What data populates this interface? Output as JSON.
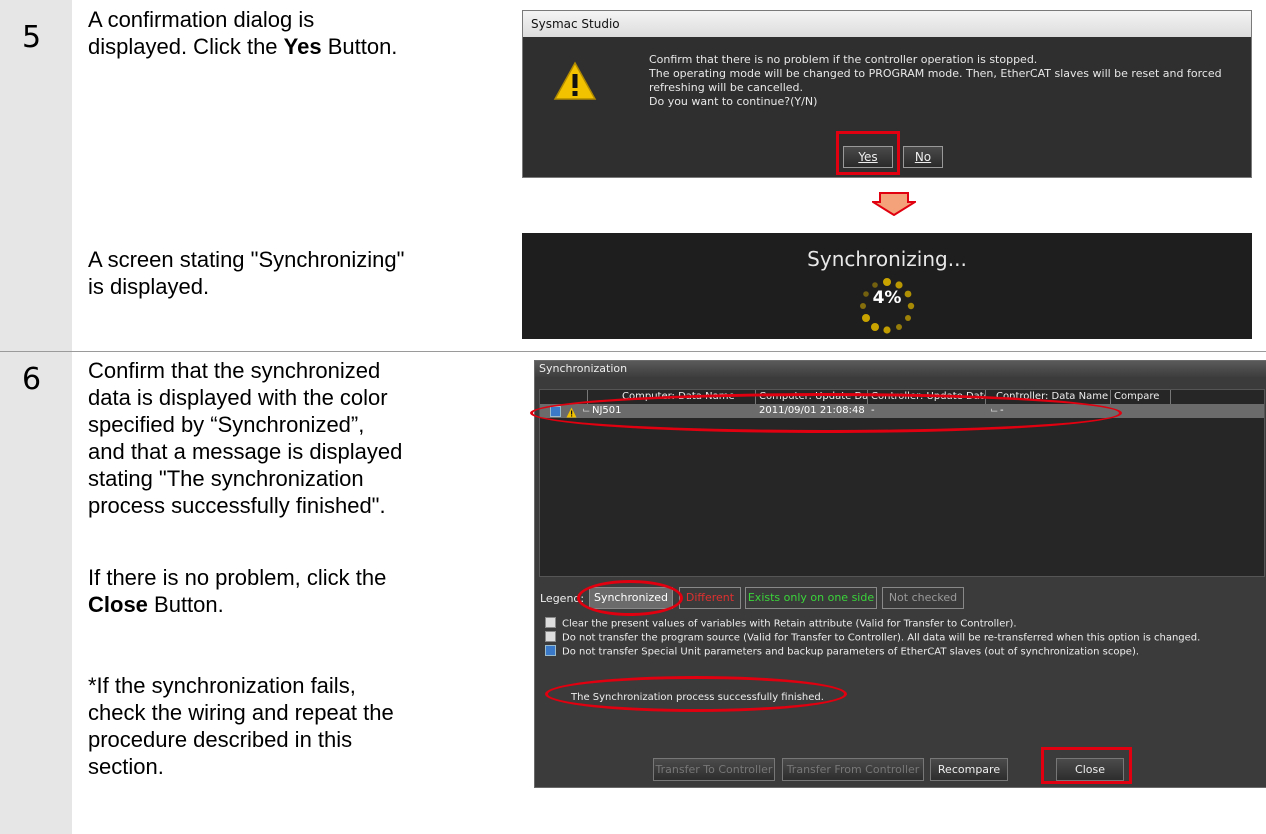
{
  "steps": [
    {
      "number": "5",
      "text_a": "A confirmation dialog is\ndisplayed. Click the ",
      "bold_a": "Yes",
      "text_a2": " Button.",
      "text_b": "A screen stating \"Synchronizing\"\nis displayed."
    },
    {
      "number": "6",
      "text_a": "Confirm that the synchronized\ndata is displayed with the color\nspecified by “Synchronized”,\nand that a message is displayed\nstating \"The synchronization\nprocess successfully finished\".",
      "text_b": "If there is no problem, click the",
      "bold_b": "Close",
      "text_b2": " Button.",
      "text_c": "*If the synchronization fails,\n check the wiring and repeat the\n procedure described in this\n section."
    }
  ],
  "confirm_dialog": {
    "title": "Sysmac Studio",
    "message": [
      "Confirm that there is no problem if the controller operation is stopped.",
      "The operating mode will be changed to PROGRAM mode. Then, EtherCAT slaves will be reset and forced refreshing will be cancelled.",
      "Do you want to continue?(Y/N)"
    ],
    "yes_label": "Yes",
    "no_label": "No"
  },
  "sync_progress": {
    "text": "Synchronizing...",
    "percent_label": "4%",
    "percent": 4
  },
  "sync_dialog": {
    "title": "Synchronization",
    "columns": [
      "Computer: Data Name",
      "Computer: Update Date",
      "Controller: Update Date",
      "Controller: Data Name",
      "Compare"
    ],
    "row": {
      "name": "NJ501",
      "computer_date": "2011/09/01 21:08:48",
      "controller_date": "-",
      "controller_name": "-"
    },
    "legend_label": "Legend:",
    "legend": [
      "Synchronized",
      "Different",
      "Exists only on one side",
      "Not checked"
    ],
    "options": [
      {
        "checked": false,
        "text": "Clear the present values of variables with Retain attribute (Valid for Transfer to Controller)."
      },
      {
        "checked": false,
        "text": "Do not transfer the program source (Valid for Transfer to Controller). All data will be re-transferred when this option is changed."
      },
      {
        "checked": true,
        "text": "Do not transfer Special Unit parameters and backup parameters of EtherCAT slaves (out of synchronization scope)."
      }
    ],
    "status_message": "The Synchronization process successfully finished.",
    "buttons": {
      "transfer_to": "Transfer To Controller",
      "transfer_from": "Transfer From Controller",
      "recompare": "Recompare",
      "close": "Close"
    }
  },
  "colors": {
    "highlight": "#e0000f",
    "arrow": "#f4a27a",
    "synchronized_bg": "#6b6b6b",
    "different": "#e03030",
    "exists_one_side": "#3ad43a",
    "not_checked": "#9a9a9a"
  }
}
